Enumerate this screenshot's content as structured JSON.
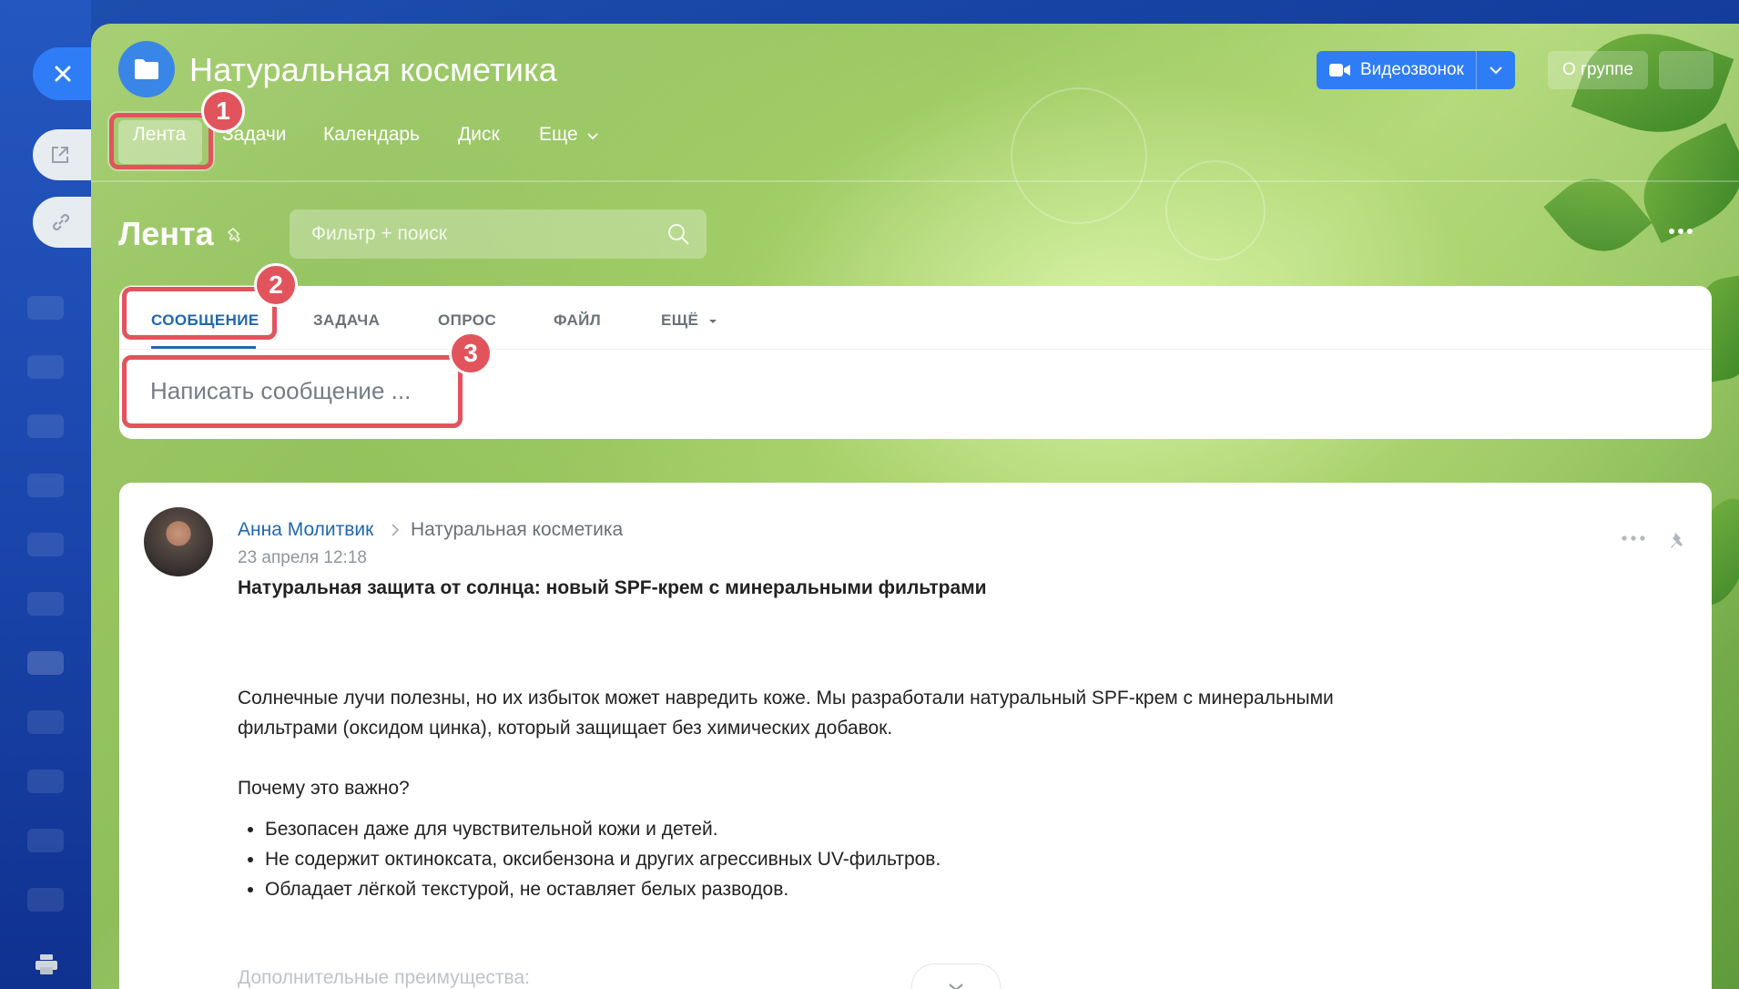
{
  "window": {
    "group_title": "Натуральная косметика",
    "video_button": "Видеозвонок",
    "about_button": "О группе"
  },
  "nav": {
    "items": [
      {
        "label": "Лента",
        "active": true
      },
      {
        "label": "Задачи"
      },
      {
        "label": "Календарь"
      },
      {
        "label": "Диск"
      },
      {
        "label": "Еще"
      }
    ]
  },
  "feed": {
    "title": "Лента",
    "search_placeholder": "Фильтр + поиск"
  },
  "composer": {
    "tabs": [
      "СООБЩЕНИЕ",
      "ЗАДАЧА",
      "ОПРОС",
      "ФАЙЛ",
      "ЕЩЁ"
    ],
    "active_tab": "СООБЩЕНИЕ",
    "placeholder": "Написать сообщение ..."
  },
  "callouts": [
    "1",
    "2",
    "3"
  ],
  "post": {
    "author": "Анна Молитвик",
    "group": "Натуральная косметика",
    "time": "23 апреля 12:18",
    "title": "Натуральная защита от солнца: новый SPF-крем с минеральными фильтрами",
    "paragraph1": "Солнечные лучи полезны, но их избыток может навредить коже. Мы разработали натуральный SPF-крем с минеральными фильтрами (оксидом цинка), который защищает без химических добавок.",
    "paragraph2": "Почему это важно?",
    "bullets": [
      "Безопасен даже для чувствительной кожи и детей.",
      "Не содержит октинoксата, оксибензона и других агрессивных UV-фильтров.",
      "Обладает лёгкой текстурой, не оставляет белых разводов."
    ],
    "faded_line": "Дополнительные преимущества:"
  },
  "colors": {
    "accent": "#2f7df6",
    "link": "#2067b0",
    "callout": "#e2545c"
  }
}
